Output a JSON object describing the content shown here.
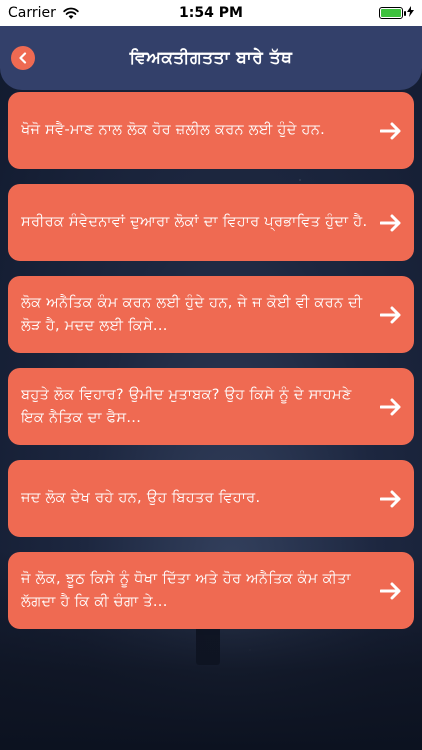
{
  "status_bar": {
    "carrier": "Carrier",
    "time": "1:54 PM",
    "battery_color": "#3ec23e"
  },
  "header": {
    "title": "ਵਿਅਕਤੀਗਤਤਾ ਬਾਰੇ ਤੱਥ",
    "back_icon": "chevron-left-icon"
  },
  "theme": {
    "accent": "#ef6a52",
    "header_bg": "#33406a"
  },
  "facts": [
    {
      "text": "ਖੋਜੋ ਸਵੈ-ਮਾਣ ਨਾਲ ਲੋਕ ਹੋਰ ਜ਼ਲੀਲ ਕਰਨ ਲਈ ਹੁੰਦੇ ਹਨ."
    },
    {
      "text": "ਸਰੀਰਕ ਸੰਵੇਦਨਾਵਾਂ ਦੁਆਰਾ ਲੋਕਾਂ ਦਾ ਵਿਹਾਰ ਪ੍ਰਭਾਵਿਤ ਹੁੰਦਾ ਹੈ."
    },
    {
      "text": "ਲੋਕ ਅਨੈਤਿਕ ਕੰਮ ਕਰਨ ਲਈ ਹੁੰਦੇ ਹਨ, ਜੇ ਜ ਕੋਈ ਵੀ ਕਰਨ ਦੀ ਲੋੜ ਹੈ, ਮਦਦ ਲਈ ਕਿਸੇ..."
    },
    {
      "text": "ਬਹੁਤੇ ਲੋਕ ਵਿਹਾਰ? ਉਮੀਦ ਮੁਤਾਬਕ? ਉਹ ਕਿਸੇ ਨੂੰ ਦੇ ਸਾਹਮਣੇ ਇਕ ਨੈਤਿਕ ਦਾ ਫੈਸ..."
    },
    {
      "text": "ਜਦ ਲੋਕ ਦੇਖ ਰਹੇ ਹਨ, ਉਹ ਬਿਹਤਰ ਵਿਹਾਰ."
    },
    {
      "text": "ਜੋ ਲੋਕ, ਝੂਠ ਕਿਸੇ ਨੂੰ ਧੋਖਾ ਦਿੱਤਾ ਅਤੇ ਹੋਰ ਅਨੈਤਿਕ ਕੰਮ ਕੀਤਾ ਲੱਗਦਾ ਹੈ ਕਿ ਕੀ ਚੰਗਾ ਤੇ..."
    }
  ],
  "card_icon": "arrow-right-icon"
}
